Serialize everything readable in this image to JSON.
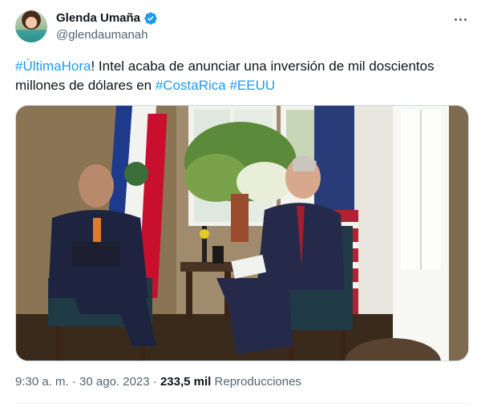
{
  "author": {
    "display_name": "Glenda Umaña",
    "handle": "@glendaumanah",
    "verified_icon": "verified-badge-icon",
    "verified_color": "#1d9bf0"
  },
  "more_icon": "more-horizontal-icon",
  "tweet": {
    "segments": [
      {
        "text": "#ÚltimaHora",
        "type": "hashtag"
      },
      {
        "text": "! Intel acaba de anunciar una inversión de mil doscientos millones de dólares en ",
        "type": "text"
      },
      {
        "text": "#CostaRica",
        "type": "hashtag"
      },
      {
        "text": " ",
        "type": "text"
      },
      {
        "text": "#EEUU",
        "type": "hashtag"
      }
    ]
  },
  "media": {
    "kind": "photo"
  },
  "meta": {
    "timestamp": "9:30 a. m. · 30 ago. 2023",
    "separator": " · ",
    "views_count": "233,5 mil",
    "views_label": "Reproducciones"
  },
  "colors": {
    "text_primary": "#0f1419",
    "text_secondary": "#536471",
    "link": "#1d9bf0",
    "border": "#cfd9de"
  }
}
